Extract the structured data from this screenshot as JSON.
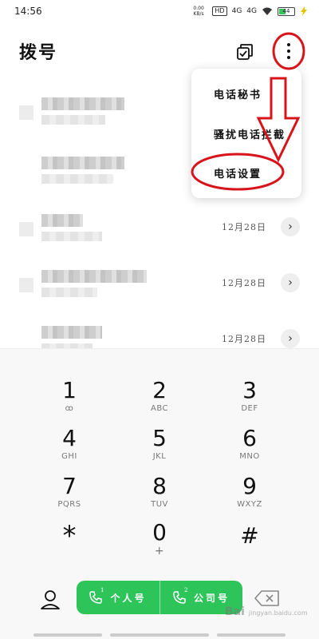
{
  "status_bar": {
    "time": "14:56",
    "net_speed": "0.00 KB/s",
    "hd": "HD",
    "sim1_signal": "4G",
    "sim2_signal": "4G",
    "battery_level": "44"
  },
  "header": {
    "title": "拨号"
  },
  "menu": {
    "items": [
      "电话秘书",
      "骚扰电话拦截",
      "电话设置"
    ]
  },
  "call_log": {
    "rows": [
      {
        "date": ""
      },
      {
        "date": ""
      },
      {
        "date": "12月28日"
      },
      {
        "date": "12月28日"
      },
      {
        "date": "12月28日"
      }
    ]
  },
  "keypad": {
    "keys": [
      {
        "digit": "1",
        "letters": "ꝏ"
      },
      {
        "digit": "2",
        "letters": "ABC"
      },
      {
        "digit": "3",
        "letters": "DEF"
      },
      {
        "digit": "4",
        "letters": "GHI"
      },
      {
        "digit": "5",
        "letters": "JKL"
      },
      {
        "digit": "6",
        "letters": "MNO"
      },
      {
        "digit": "7",
        "letters": "PQRS"
      },
      {
        "digit": "8",
        "letters": "TUV"
      },
      {
        "digit": "9",
        "letters": "WXYZ"
      },
      {
        "digit": "*",
        "letters": ""
      },
      {
        "digit": "0",
        "letters": "+"
      },
      {
        "digit": "#",
        "letters": ""
      }
    ]
  },
  "bottom": {
    "call_sim1_label": "个人号",
    "call_sim2_label": "公司号",
    "sim1_badge": "1",
    "sim2_badge": "2",
    "watermark": "Bai",
    "watermark_suffix": "jingyan.baidu.com"
  },
  "colors": {
    "accent_green": "#2dc45a",
    "annotation_red": "#d8141b"
  }
}
